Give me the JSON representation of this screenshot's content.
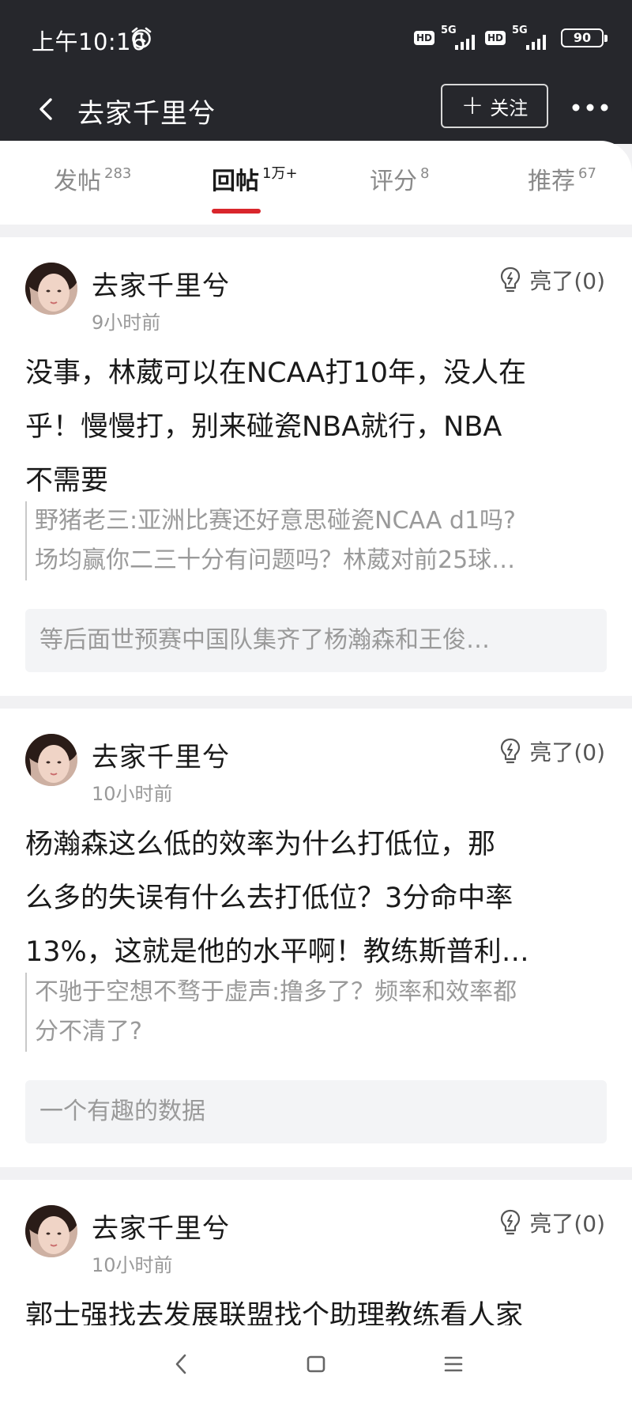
{
  "status_bar": {
    "time": "上午10:16",
    "network_1": "5G",
    "network_2": "5G",
    "hd_label": "HD",
    "battery": "90"
  },
  "header": {
    "title": "去家千里兮",
    "follow_label": "关注"
  },
  "tabs": [
    {
      "label": "发帖",
      "count": "283"
    },
    {
      "label": "回帖",
      "count": "1万+"
    },
    {
      "label": "评分",
      "count": "8"
    },
    {
      "label": "推荐",
      "count": "67"
    }
  ],
  "posts": [
    {
      "user": "去家千里兮",
      "time": "9小时前",
      "like": "亮了(0)",
      "content_lines": [
        "没事，林葳可以在NCAA打10年，没人在",
        "乎！慢慢打，别来碰瓷NBA就行，NBA",
        "不需要"
      ],
      "quote_lines": [
        "野猪老三:亚洲比赛还好意思碰瓷NCAA d1吗?",
        "场均赢你二三十分有问题吗？林葳对前25球…"
      ],
      "reply": "等后面世预赛中国队集齐了杨瀚森和王俊…"
    },
    {
      "user": "去家千里兮",
      "time": "10小时前",
      "like": "亮了(0)",
      "content_lines": [
        "杨瀚森这么低的效率为什么打低位，那",
        "么多的失误有什么去打低位？3分命中率",
        "13%，这就是他的水平啊！教练斯普利…"
      ],
      "quote_lines": [
        "不驰于空想不骛于虚声:撸多了？频率和效率都",
        "分不清了?"
      ],
      "reply": "一个有趣的数据"
    },
    {
      "user": "去家千里兮",
      "time": "10小时前",
      "like": "亮了(0)",
      "content_lines": [
        "郭士强找去发展联盟找个助理教练看人家"
      ]
    }
  ]
}
